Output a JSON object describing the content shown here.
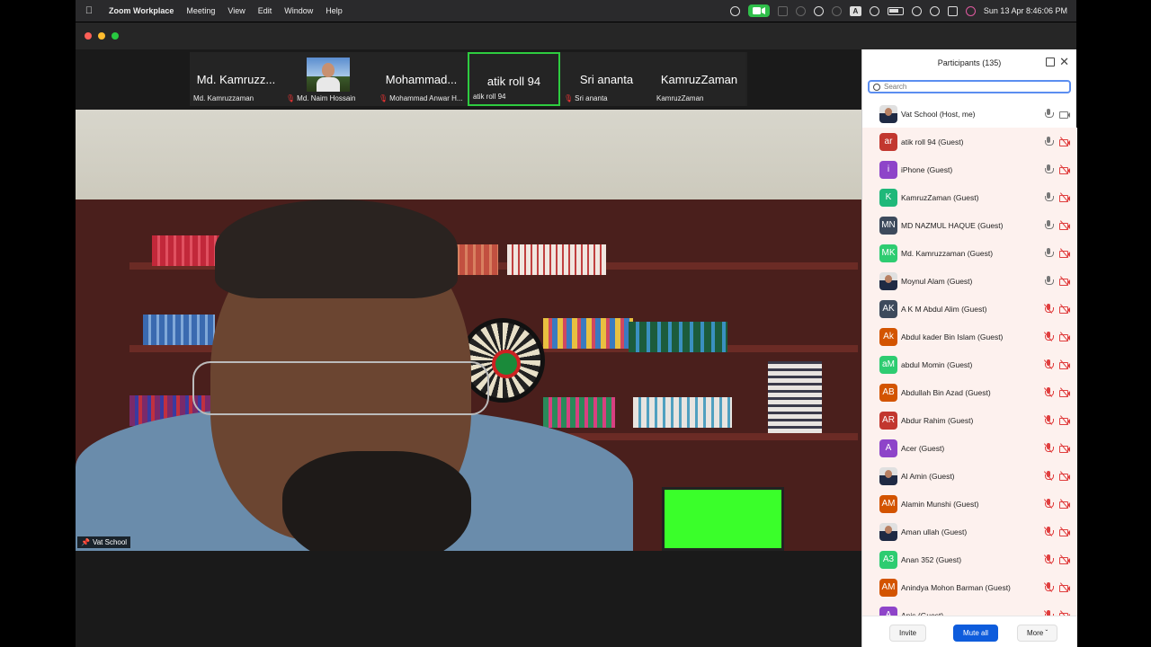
{
  "menubar": {
    "app_name": "Zoom Workplace",
    "menus": [
      "Meeting",
      "View",
      "Edit",
      "Window",
      "Help"
    ],
    "clock": "Sun 13 Apr  8:46:06 PM",
    "camera_status_color": "#2fbf4a",
    "status_icons": [
      "record-icon",
      "camera-active-icon",
      "screen-icon",
      "moon-icon",
      "info-icon",
      "airdrop-icon",
      "keyboard-input-icon",
      "user-icon",
      "battery-icon",
      "wifi-icon",
      "search-icon",
      "control-center-icon",
      "siri-icon"
    ],
    "input_letter": "A"
  },
  "window": {
    "traffic_lights": [
      "#fe5f57",
      "#febc2e",
      "#28c840"
    ]
  },
  "strip": [
    {
      "big": "Md. Kamruzz...",
      "small": "Md. Kamruzzaman",
      "muted": false,
      "active": false,
      "photo": false
    },
    {
      "big": "",
      "small": "Md. Naim Hossain",
      "muted": true,
      "active": false,
      "photo": true
    },
    {
      "big": "Mohammad...",
      "small": "Mohammad Anwar H...",
      "muted": true,
      "active": false,
      "photo": false
    },
    {
      "big": "atik    roll 94",
      "small": "atik    roll 94",
      "muted": false,
      "active": true,
      "photo": false
    },
    {
      "big": "Sri ananta",
      "small": "Sri ananta",
      "muted": true,
      "active": false,
      "photo": false
    },
    {
      "big": "KamruzZaman",
      "small": "KamruzZaman",
      "muted": false,
      "active": false,
      "photo": false
    }
  ],
  "main_video": {
    "name_tag": "Vat School"
  },
  "participants": {
    "title": "Participants (135)",
    "search_placeholder": "Search",
    "list": [
      {
        "name": "Vat School (Host, me)",
        "initials": "",
        "color": "",
        "photo": true,
        "mic_off": false,
        "cam_off": false,
        "host": true
      },
      {
        "name": "atik    roll 94 (Guest)",
        "initials": "ar",
        "color": "#c2372f",
        "photo": false,
        "mic_off": false,
        "cam_off": true
      },
      {
        "name": "iPhone (Guest)",
        "initials": "i",
        "color": "#8e44c9",
        "photo": false,
        "mic_off": false,
        "cam_off": true
      },
      {
        "name": "KamruzZaman (Guest)",
        "initials": "K",
        "color": "#1fb879",
        "photo": false,
        "mic_off": false,
        "cam_off": true
      },
      {
        "name": "MD NAZMUL HAQUE (Guest)",
        "initials": "MN",
        "color": "#3d4a5c",
        "photo": false,
        "mic_off": false,
        "cam_off": true
      },
      {
        "name": "Md. Kamruzzaman (Guest)",
        "initials": "MK",
        "color": "#2ecc71",
        "photo": false,
        "mic_off": false,
        "cam_off": true
      },
      {
        "name": "Moynul Alam (Guest)",
        "initials": "",
        "color": "",
        "photo": true,
        "mic_off": false,
        "cam_off": true
      },
      {
        "name": "A K M Abdul Alim (Guest)",
        "initials": "AK",
        "color": "#3d4a5c",
        "photo": false,
        "mic_off": true,
        "cam_off": true
      },
      {
        "name": "Abdul kader Bin Islam (Guest)",
        "initials": "Ak",
        "color": "#d35400",
        "photo": false,
        "mic_off": true,
        "cam_off": true
      },
      {
        "name": "abdul Momin (Guest)",
        "initials": "aM",
        "color": "#2ecc71",
        "photo": false,
        "mic_off": true,
        "cam_off": true
      },
      {
        "name": "Abdullah Bin Azad (Guest)",
        "initials": "AB",
        "color": "#d35400",
        "photo": false,
        "mic_off": true,
        "cam_off": true
      },
      {
        "name": "Abdur Rahim (Guest)",
        "initials": "AR",
        "color": "#c2372f",
        "photo": false,
        "mic_off": true,
        "cam_off": true
      },
      {
        "name": "Acer (Guest)",
        "initials": "A",
        "color": "#8e44c9",
        "photo": false,
        "mic_off": true,
        "cam_off": true
      },
      {
        "name": "Al Amin (Guest)",
        "initials": "",
        "color": "",
        "photo": true,
        "mic_off": true,
        "cam_off": true
      },
      {
        "name": "Alamin Munshi (Guest)",
        "initials": "AM",
        "color": "#d35400",
        "photo": false,
        "mic_off": true,
        "cam_off": true
      },
      {
        "name": "Aman ullah (Guest)",
        "initials": "",
        "color": "",
        "photo": true,
        "mic_off": true,
        "cam_off": true
      },
      {
        "name": "Anan 352 (Guest)",
        "initials": "A3",
        "color": "#2ecc71",
        "photo": false,
        "mic_off": true,
        "cam_off": true
      },
      {
        "name": "Anindya Mohon Barman (Guest)",
        "initials": "AM",
        "color": "#d35400",
        "photo": false,
        "mic_off": true,
        "cam_off": true
      },
      {
        "name": "Anis (Guest)",
        "initials": "A",
        "color": "#8e44c9",
        "photo": false,
        "mic_off": true,
        "cam_off": true
      }
    ],
    "footer": {
      "invite": "Invite",
      "mute_all": "Mute all",
      "more": "More"
    }
  }
}
